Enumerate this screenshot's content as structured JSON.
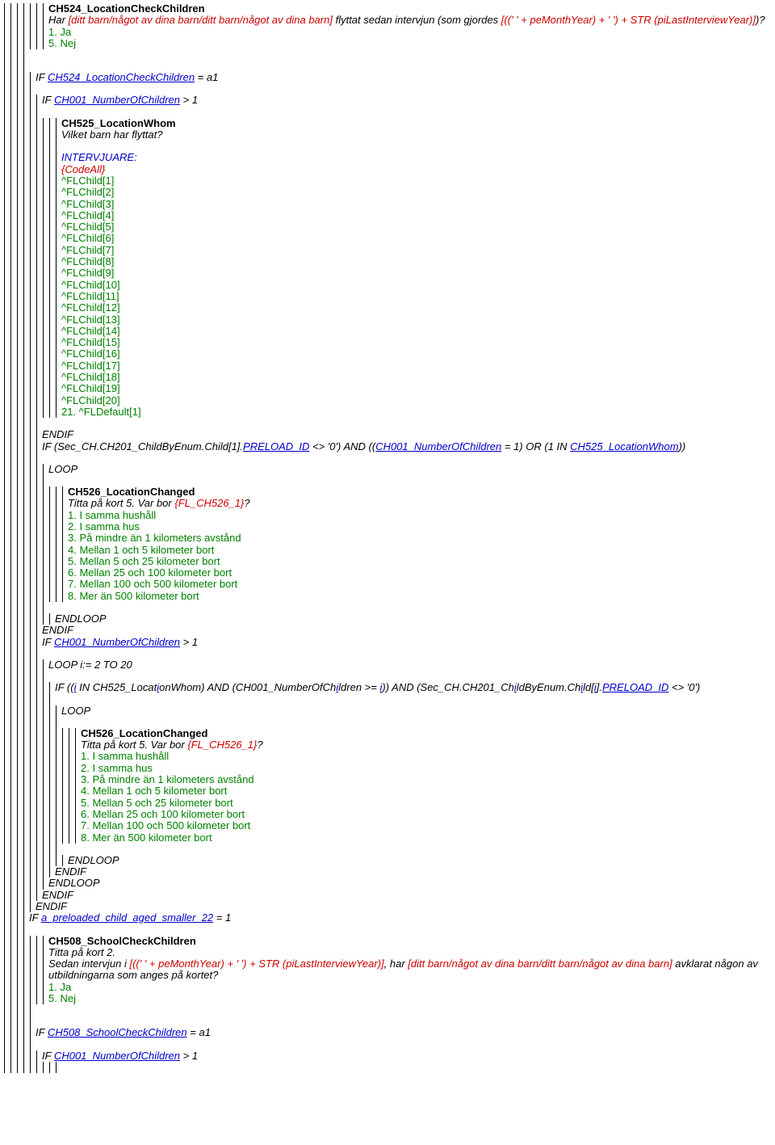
{
  "ch524": {
    "title": "CH524_LocationCheckChildren",
    "q_pre": "Har ",
    "q_red1": "[ditt barn/något av dina barn/ditt barn/något av dina barn]",
    "q_mid": " flyttat sedan intervjun (som gjordes ",
    "q_red2": "[((' ' + peMonthYear) + ' ') + STR (piLastInterviewYear)]",
    "q_post": ")?",
    "a1": "1. Ja",
    "a5": "5. Nej"
  },
  "if524": {
    "if_pre": "IF ",
    "link": "CH524_LocationCheckChildren",
    "post": " = a1"
  },
  "if_numchild_gt1": {
    "pre": "IF ",
    "link": "CH001_NumberOfChildren",
    "post": " > 1"
  },
  "ch525": {
    "title": "CH525_LocationWhom",
    "q": "Vilket barn har flyttat?",
    "intv": "INTERVJUARE:",
    "codeall": "{CodeAll}",
    "children": [
      "^FLChild[1]",
      "^FLChild[2]",
      "^FLChild[3]",
      "^FLChild[4]",
      "^FLChild[5]",
      "^FLChild[6]",
      "^FLChild[7]",
      "^FLChild[8]",
      "^FLChild[9]",
      "^FLChild[10]",
      "^FLChild[11]",
      "^FLChild[12]",
      "^FLChild[13]",
      "^FLChild[14]",
      "^FLChild[15]",
      "^FLChild[16]",
      "^FLChild[17]",
      "^FLChild[18]",
      "^FLChild[19]",
      "^FLChild[20]"
    ],
    "last": "21. ^FLDefault[1]"
  },
  "endif_plain": "ENDIF",
  "if_sec": {
    "pre": "IF (Sec_CH.CH201_ChildByEnum.Child[1].",
    "link1": "PRELOAD_ID",
    "mid1": " <> '0') AND ((",
    "link2": "CH001_NumberOfChildren",
    "mid2": " = 1) OR (1 IN ",
    "link3": "CH525_LocationWhom",
    "post": "))"
  },
  "loop": "LOOP",
  "ch526": {
    "title": "CH526_LocationChanged",
    "q_pre": "Titta på kort 5. Var bor ",
    "q_red": "{FL_CH526_1}",
    "q_post": "?",
    "a1": "1. I samma hushåll",
    "a2": "2. I samma hus",
    "a3": "3. På mindre än 1 kilometers avstånd",
    "a4": "4. Mellan 1 och 5 kilometer bort",
    "a5": "5. Mellan 5 och 25 kilometer bort",
    "a6": "6. Mellan 25 och 100 kilometer bort",
    "a7": "7. Mellan 100 och 500 kilometer bort",
    "a8": "8. Mer än 500 kilometer bort"
  },
  "endloop": "ENDLOOP",
  "loop_i": "LOOP i:= 2 TO 20",
  "if_i": {
    "pre": "IF ((",
    "i1": "i",
    "t1": " IN CH525_Locat",
    "i2": "i",
    "t2": "onWhom) AND (CH001_NumberOfCh",
    "i3": "i",
    "t3": "ldren >= ",
    "i4": "i",
    "t4": ")) AND (Sec_CH.CH201_Ch",
    "i5": "i",
    "t5": "ldByEnum.Ch",
    "i6": "i",
    "t6": "ld[",
    "i7": "i",
    "t7": "].",
    "link": "PRELOAD_ID",
    "post": " <> '0')"
  },
  "if_pre22": {
    "pre": "IF ",
    "link": "a_preloaded_child_aged_smaller_22",
    "post": " = 1"
  },
  "ch508": {
    "title": "CH508_SchoolCheckChildren",
    "q1": "Titta på kort 2.",
    "q2_pre": "Sedan intervjun i ",
    "q2_red1": "[((' ' + peMonthYear) + ' ') + STR (piLastInterviewYear)]",
    "q2_mid": ", har ",
    "q2_red2": "[ditt barn/något av dina barn/ditt barn/något av dina barn]",
    "q2_post": " avklarat någon av utbildningarna som anges på kortet?",
    "a1": "1. Ja",
    "a5": "5. Nej"
  },
  "if508": {
    "pre": "IF ",
    "link": "CH508_SchoolCheckChildren",
    "post": " = a1"
  }
}
